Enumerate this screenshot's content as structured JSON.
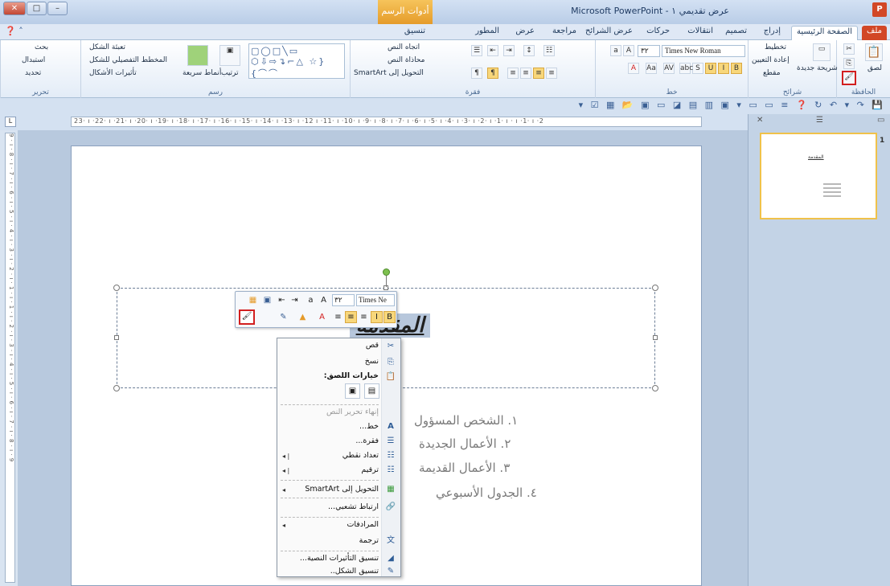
{
  "window": {
    "app_title": "عرض تقديمي ١ - Microsoft PowerPoint",
    "contextual_tab_header": "أدوات الرسم",
    "app_icon": "P"
  },
  "tabs": [
    {
      "label": "ملف"
    },
    {
      "label": "الصفحة الرئيسية"
    },
    {
      "label": "إدراج"
    },
    {
      "label": "تصميم"
    },
    {
      "label": "انتقالات"
    },
    {
      "label": "حركات"
    },
    {
      "label": "عرض الشرائح"
    },
    {
      "label": "مراجعة"
    },
    {
      "label": "عرض"
    },
    {
      "label": "المطور"
    },
    {
      "label": "تنسيق"
    }
  ],
  "ribbon": {
    "clipboard": {
      "label": "الحافظة",
      "paste": "لصق"
    },
    "slides": {
      "label": "شرائح",
      "new_slide": "شريحة جديدة",
      "layout": "تخطيط",
      "reset": "إعادة التعيين",
      "section": "مقطع"
    },
    "font": {
      "label": "خط",
      "font_name": "Times New Roman",
      "font_size": "٣٢"
    },
    "paragraph": {
      "label": "فقرة",
      "text_direction": "اتجاه النص",
      "align_text": "محاذاة النص",
      "convert_smartart": "التحويل إلى SmartArt"
    },
    "drawing": {
      "label": "رسم",
      "arrange": "ترتيب",
      "quick_styles": "أنماط سريعة",
      "shape_fill": "تعبئة الشكل",
      "shape_outline": "المخطط التفصيلي للشكل",
      "shape_effects": "تأثيرات الأشكال"
    },
    "editing": {
      "label": "تحرير",
      "find": "بحث",
      "replace": "استبدال",
      "select": "تحديد"
    }
  },
  "ruler": {
    "horizontal": "23· ı ·22· ı ·21· ı ·20· ı ·19· ı ·18· ı ·17· ı ·16· ı ·15· ı ·14· ı ·13· ı ·12 ı ·11· ı ·10· ı ·9· ı ·8· ı ·7· ı ·6· ı ·5· ı ·4· ı ·3· ı ·2· ı ·1· ı · ı ·1· ı ·2",
    "vertical": "9 · ı · 8 · ı · 7 · ı · 6 · ı · 5 · ı · 4 · ı · 3 · ı · 2 · ı · 1 · ı · 1 · ı · 2 · ı · 3 · ı · 4 · ı · 5 · ı · 6 · ı · 7 · ı · 8 · ı · 9"
  },
  "slide": {
    "title": "المقدمة",
    "bullets": [
      "١.   الشخص المسؤول",
      "٢.   الأعمال الجديدة",
      "٣.   الأعمال القديمة",
      "٤.   الجدول الأسبوعي"
    ]
  },
  "mini_toolbar": {
    "font_name": "Times Ne",
    "font_size": "٣٢"
  },
  "context_menu": {
    "cut": "قص",
    "copy": "نسخ",
    "paste_options": "خيارات اللصق:",
    "exit_edit": "إنهاء تحرير النص",
    "font": "خط...",
    "paragraph": "فقرة...",
    "bullets": "تعداد نقطي",
    "numbering": "ترقيم",
    "convert_smartart": "التحويل إلى SmartArt",
    "hyperlink": "ارتباط تشعبي...",
    "synonyms": "المرادفات",
    "translate": "ترجمة",
    "format_text_effects": "تنسيق التأثيرات النصية...",
    "format_shape": "تنسيق الشكل.."
  },
  "slides_pane": {
    "thumbnail_number": "1",
    "thumbnail_title": "المقدمة"
  },
  "colors": {
    "accent_file_tab": "#d24726",
    "highlight": "#f8d77b",
    "annotation_red": "#d21f1f",
    "contextual_orange": "#e59b2a"
  }
}
